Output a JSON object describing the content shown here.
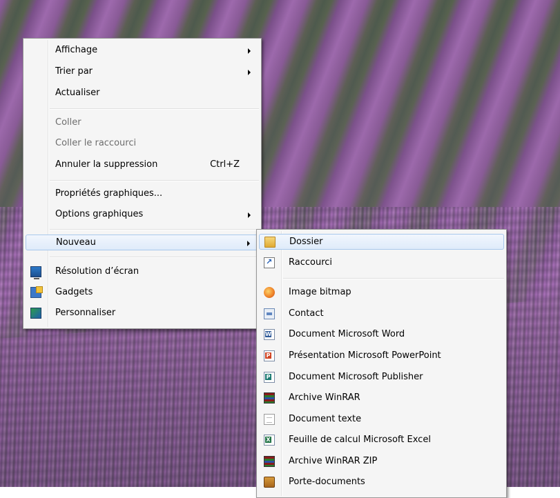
{
  "desktop_menu": {
    "items": [
      {
        "label": "Affichage",
        "submenu": true
      },
      {
        "label": "Trier par",
        "submenu": true
      },
      {
        "label": "Actualiser"
      },
      {
        "label": "Coller",
        "disabled": true
      },
      {
        "label": "Coller le raccourci",
        "disabled": true
      },
      {
        "label": "Annuler la suppression",
        "shortcut": "Ctrl+Z"
      },
      {
        "label": "Propriétés graphiques..."
      },
      {
        "label": "Options graphiques",
        "submenu": true
      },
      {
        "label": "Nouveau",
        "submenu": true,
        "highlighted": true
      },
      {
        "label": "Résolution d’écran",
        "icon": "screen-resolution-icon"
      },
      {
        "label": "Gadgets",
        "icon": "gadgets-icon"
      },
      {
        "label": "Personnaliser",
        "icon": "personalize-icon"
      }
    ]
  },
  "new_submenu": {
    "items": [
      {
        "label": "Dossier",
        "icon": "folder-icon",
        "highlighted": true
      },
      {
        "label": "Raccourci",
        "icon": "shortcut-icon"
      },
      {
        "label": "Image bitmap",
        "icon": "bitmap-image-icon"
      },
      {
        "label": "Contact",
        "icon": "contact-icon"
      },
      {
        "label": "Document Microsoft Word",
        "icon": "word-document-icon"
      },
      {
        "label": "Présentation Microsoft PowerPoint",
        "icon": "powerpoint-document-icon"
      },
      {
        "label": "Document Microsoft Publisher",
        "icon": "publisher-document-icon"
      },
      {
        "label": "Archive WinRAR",
        "icon": "winrar-archive-icon"
      },
      {
        "label": "Document texte",
        "icon": "text-document-icon"
      },
      {
        "label": "Feuille de calcul Microsoft Excel",
        "icon": "excel-spreadsheet-icon"
      },
      {
        "label": "Archive WinRAR ZIP",
        "icon": "winrar-zip-icon"
      },
      {
        "label": "Porte-documents",
        "icon": "briefcase-icon"
      }
    ]
  }
}
